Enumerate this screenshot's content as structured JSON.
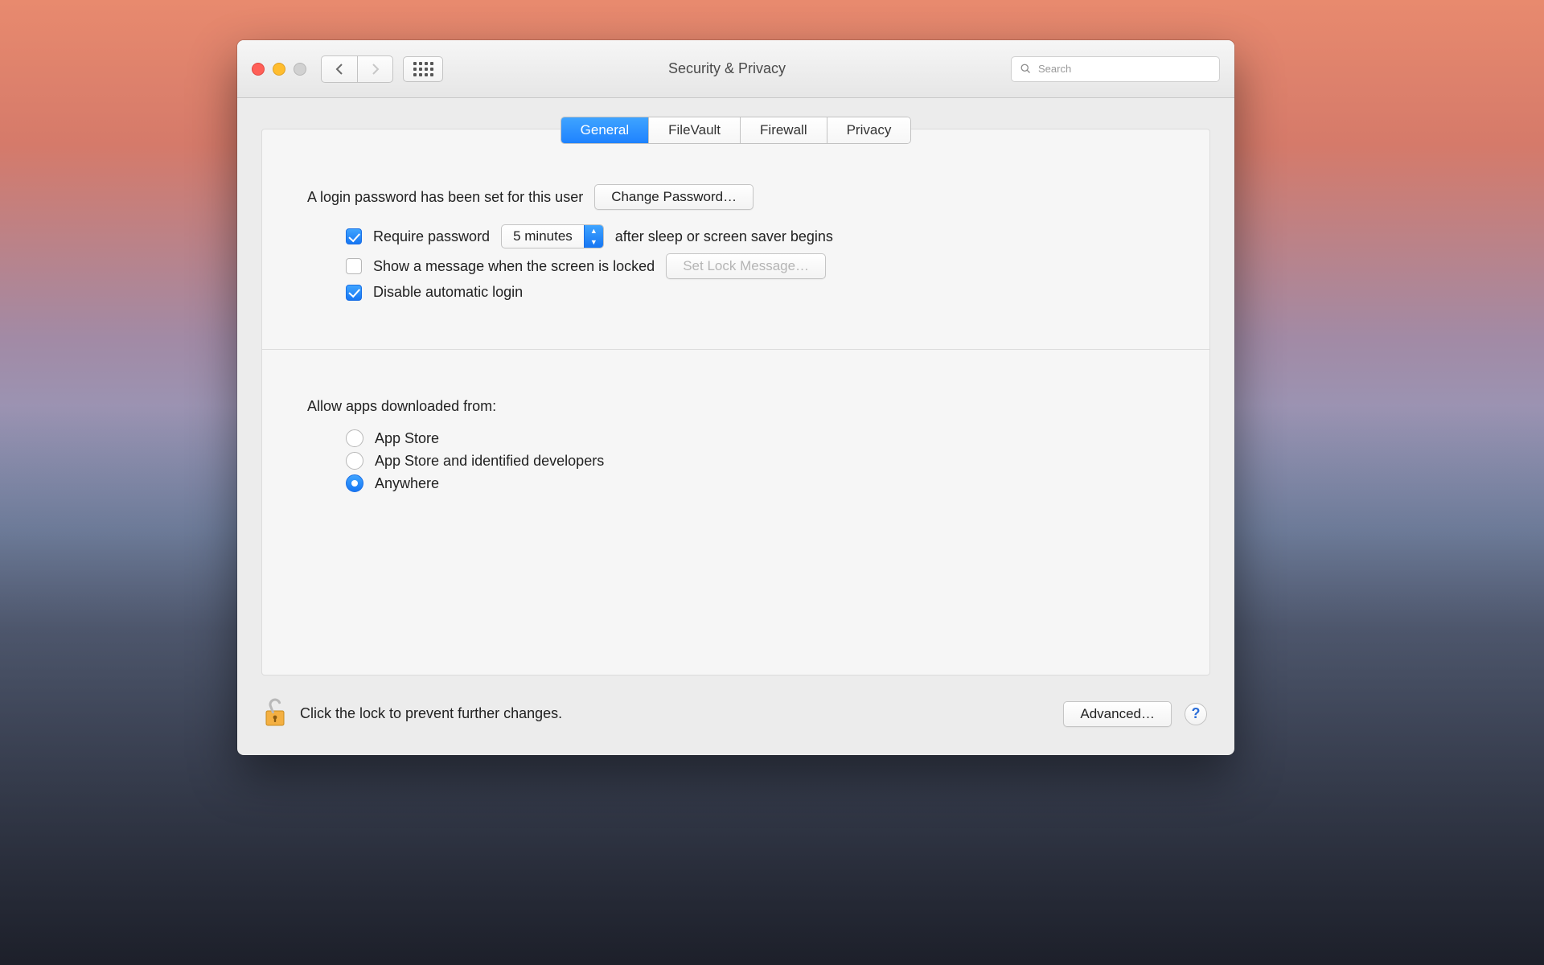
{
  "window": {
    "title": "Security & Privacy"
  },
  "toolbar": {
    "search_placeholder": "Search"
  },
  "tabs": [
    {
      "label": "General",
      "active": true
    },
    {
      "label": "FileVault",
      "active": false
    },
    {
      "label": "Firewall",
      "active": false
    },
    {
      "label": "Privacy",
      "active": false
    }
  ],
  "login": {
    "password_set_text": "A login password has been set for this user",
    "change_password_label": "Change Password…",
    "require_password_label": "Require password",
    "require_password_checked": true,
    "delay_selected": "5 minutes",
    "after_sleep_text": "after sleep or screen saver begins",
    "show_message_label": "Show a message when the screen is locked",
    "show_message_checked": false,
    "set_lock_message_label": "Set Lock Message…",
    "disable_autologin_label": "Disable automatic login",
    "disable_autologin_checked": true
  },
  "gatekeeper": {
    "heading": "Allow apps downloaded from:",
    "options": [
      {
        "label": "App Store",
        "selected": false
      },
      {
        "label": "App Store and identified developers",
        "selected": false
      },
      {
        "label": "Anywhere",
        "selected": true
      }
    ]
  },
  "footer": {
    "lock_text": "Click the lock to prevent further changes.",
    "advanced_label": "Advanced…"
  }
}
